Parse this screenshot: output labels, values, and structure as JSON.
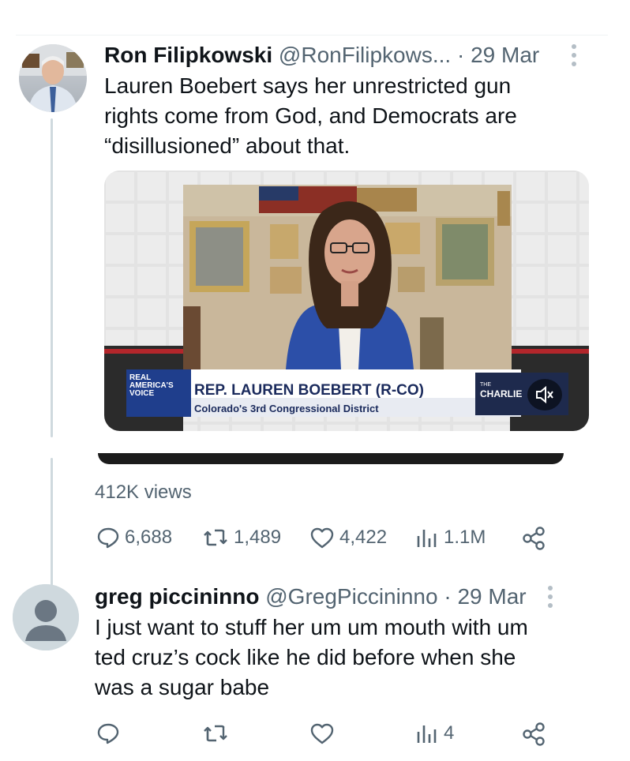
{
  "tweet": {
    "author_name": "Ron Filipkowski",
    "author_handle": "@RonFilipkows...",
    "date": "· 29 Mar",
    "text_lines": [
      "Lauren Boebert says her unrestricted gun",
      "rights come from God, and Democrats are",
      "“disillusioned” about that."
    ],
    "video": {
      "brand_line1": "REAL",
      "brand_line2": "AMERICA'S",
      "brand_line3": "VOICE",
      "lower_third_title": "REP. LAUREN BOEBERT (R-CO)",
      "lower_third_subtitle": "Colorado's 3rd Congressional District",
      "show_small": "THE",
      "show_name": "CHARLIE"
    },
    "views": "412K views",
    "replies": "6,688",
    "reposts": "1,489",
    "likes": "4,422",
    "views_count": "1.1M"
  },
  "reply": {
    "author_name": "greg piccininno",
    "author_handle": "@GregPiccininno",
    "date": "· 29 Mar",
    "text_lines": [
      "I just want to stuff her um um mouth with um",
      "ted cruz’s cock like he did before when she",
      "was a sugar babe"
    ],
    "views_count": "4"
  },
  "icons": [
    "reply-icon",
    "repost-icon",
    "like-icon",
    "views-icon",
    "share-icon",
    "more-icon",
    "mute-icon"
  ]
}
